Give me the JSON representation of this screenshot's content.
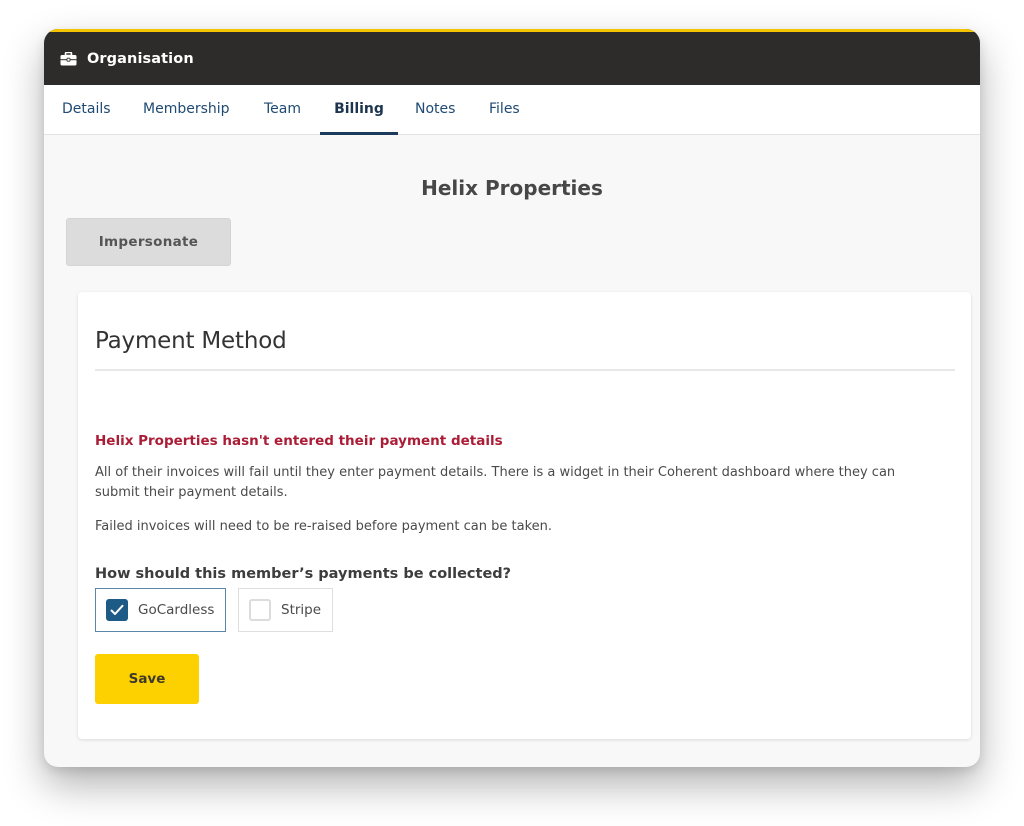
{
  "header": {
    "icon": "briefcase-icon",
    "title": "Organisation"
  },
  "tabs": [
    {
      "label": "Details",
      "active": false
    },
    {
      "label": "Membership",
      "active": false
    },
    {
      "label": "Team",
      "active": false
    },
    {
      "label": "Billing",
      "active": true
    },
    {
      "label": "Notes",
      "active": false
    },
    {
      "label": "Files",
      "active": false
    }
  ],
  "organisation_name": "Helix Properties",
  "impersonate_label": "Impersonate",
  "payment_method": {
    "title": "Payment Method",
    "alert_title": "Helix Properties hasn't entered their payment details",
    "paragraph1": "All of their invoices will fail until they enter payment details. There is a widget in their Coherent dashboard where they can submit their payment details.",
    "paragraph2": "Failed invoices will need to be re-raised before payment can be taken.",
    "question": "How should this member’s payments be collected?",
    "options": [
      {
        "label": "GoCardless",
        "checked": true
      },
      {
        "label": "Stripe",
        "checked": false
      }
    ],
    "save_label": "Save"
  },
  "colors": {
    "accent_yellow": "#fdd000",
    "header_bg": "#2d2c2b",
    "alert_red": "#ab1d36",
    "tab_blue": "#1e4a73",
    "checkbox_blue": "#1d5a86"
  }
}
